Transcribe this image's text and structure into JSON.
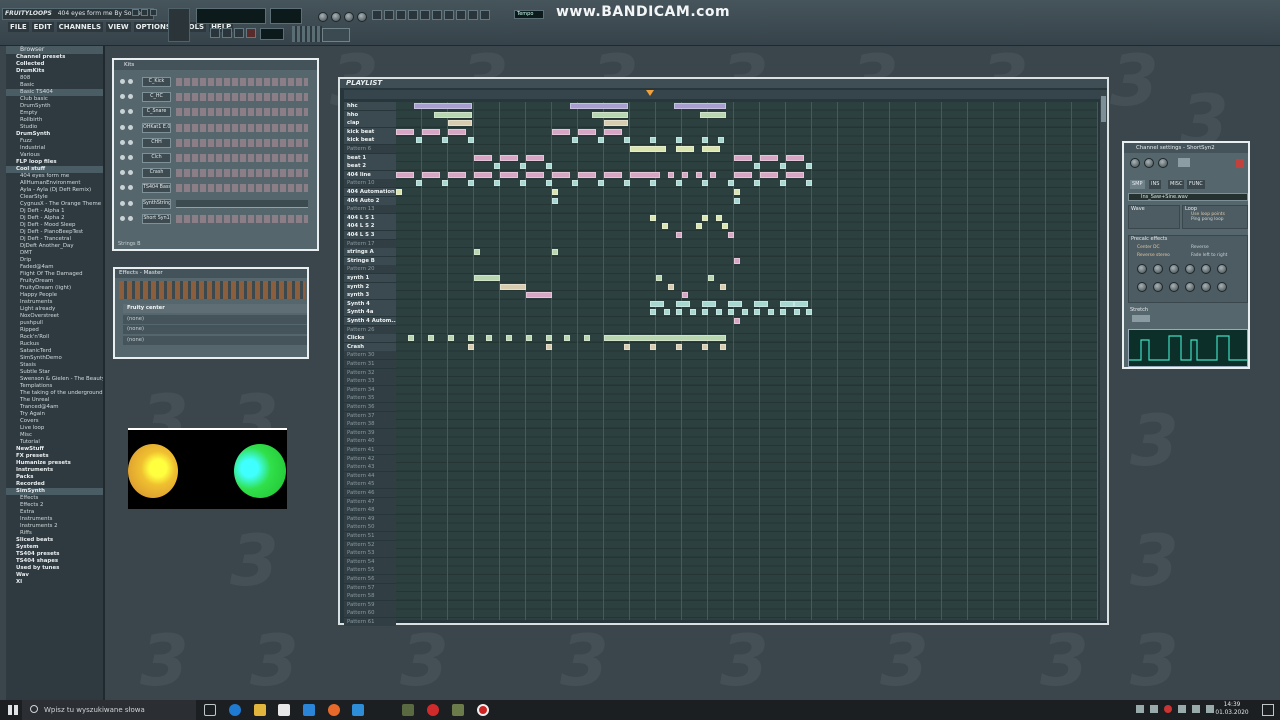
{
  "app": {
    "window_title": "FRUITYLOOPS",
    "song_title": "404 eyes form me By Sorcer",
    "menus": [
      "FILE",
      "EDIT",
      "CHANNELS",
      "VIEW",
      "OPTIONS",
      "TOOLS",
      "HELP"
    ],
    "tempo_label": "Tempo",
    "recorder_watermark": "www.BANDICAM.com",
    "bg_watermark_digit": "3"
  },
  "browser": {
    "title": "Browser",
    "items": [
      {
        "label": "Channel presets",
        "type": "folder"
      },
      {
        "label": "Collected",
        "type": "folder"
      },
      {
        "label": "DrumKits",
        "type": "folder"
      },
      {
        "label": "808",
        "type": "item"
      },
      {
        "label": "Basic",
        "type": "item"
      },
      {
        "label": "Basic TS404",
        "type": "item",
        "selected": true
      },
      {
        "label": "Club basic",
        "type": "item"
      },
      {
        "label": "DrumSynth",
        "type": "item"
      },
      {
        "label": "Empty",
        "type": "item"
      },
      {
        "label": "Rollbirth",
        "type": "item"
      },
      {
        "label": "Studio",
        "type": "item"
      },
      {
        "label": "DrumSynth",
        "type": "folder"
      },
      {
        "label": "Fuzz",
        "type": "item"
      },
      {
        "label": "Industrial",
        "type": "item"
      },
      {
        "label": "Various",
        "type": "item"
      },
      {
        "label": "FLP loop files",
        "type": "folder"
      },
      {
        "label": "Cool stuff",
        "type": "folder",
        "selected": true
      },
      {
        "label": "404 eyes form me",
        "type": "item"
      },
      {
        "label": "AllHumanEnvironment",
        "type": "item"
      },
      {
        "label": "Ayla - Ayla (Dj Deft Remix)",
        "type": "item"
      },
      {
        "label": "ClearStyle",
        "type": "item"
      },
      {
        "label": "CygnusX - The Orange Theme",
        "type": "item"
      },
      {
        "label": "Dj Deft - Alpha 1",
        "type": "item"
      },
      {
        "label": "Dj Deft - Alpha 2",
        "type": "item"
      },
      {
        "label": "Dj Deft - Mood Sleep",
        "type": "item"
      },
      {
        "label": "Dj Deft - PianoBeepTest",
        "type": "item"
      },
      {
        "label": "Dj Deft - Trancetral",
        "type": "item"
      },
      {
        "label": "DjDeft Another_Day",
        "type": "item"
      },
      {
        "label": "DMT",
        "type": "item"
      },
      {
        "label": "Drip",
        "type": "item"
      },
      {
        "label": "Faded@4am",
        "type": "item"
      },
      {
        "label": "Flight Of The Damaged",
        "type": "item"
      },
      {
        "label": "FruityDream",
        "type": "item"
      },
      {
        "label": "FruityDream (light)",
        "type": "item"
      },
      {
        "label": "Happy People",
        "type": "item"
      },
      {
        "label": "Instruments",
        "type": "item"
      },
      {
        "label": "Light already",
        "type": "item"
      },
      {
        "label": "NoxOverstreet",
        "type": "item"
      },
      {
        "label": "pushpull",
        "type": "item"
      },
      {
        "label": "Ripped",
        "type": "item"
      },
      {
        "label": "Rock'n'Roll",
        "type": "item"
      },
      {
        "label": "Ruckus",
        "type": "item"
      },
      {
        "label": "SatanicTerd",
        "type": "item"
      },
      {
        "label": "SimSynthDemo",
        "type": "item"
      },
      {
        "label": "Stasis",
        "type": "item"
      },
      {
        "label": "Subtle Star",
        "type": "item"
      },
      {
        "label": "Swenson & Gielen - The Beauty",
        "type": "item"
      },
      {
        "label": "Templations",
        "type": "item"
      },
      {
        "label": "The taking of the underground",
        "type": "item"
      },
      {
        "label": "The Unreal",
        "type": "item"
      },
      {
        "label": "Tranced@4am",
        "type": "item"
      },
      {
        "label": "Try Again",
        "type": "item"
      },
      {
        "label": "Covers",
        "type": "item"
      },
      {
        "label": "Live loop",
        "type": "item"
      },
      {
        "label": "Misc",
        "type": "item"
      },
      {
        "label": "Tutorial",
        "type": "item"
      },
      {
        "label": "NewStuff",
        "type": "folder"
      },
      {
        "label": "FX presets",
        "type": "folder"
      },
      {
        "label": "Humanize presets",
        "type": "folder"
      },
      {
        "label": "Instruments",
        "type": "folder"
      },
      {
        "label": "Packs",
        "type": "folder"
      },
      {
        "label": "Recorded",
        "type": "folder"
      },
      {
        "label": "SimSynth",
        "type": "folder",
        "selected": true
      },
      {
        "label": "Effects",
        "type": "item"
      },
      {
        "label": "Effects 2",
        "type": "item"
      },
      {
        "label": "Extra",
        "type": "item"
      },
      {
        "label": "Instruments",
        "type": "item"
      },
      {
        "label": "Instruments 2",
        "type": "item"
      },
      {
        "label": "Riffs",
        "type": "item"
      },
      {
        "label": "Sliced beats",
        "type": "folder"
      },
      {
        "label": "System",
        "type": "folder"
      },
      {
        "label": "TS404 presets",
        "type": "folder"
      },
      {
        "label": "TS404 shapes",
        "type": "folder"
      },
      {
        "label": "Used by tunes",
        "type": "folder"
      },
      {
        "label": "Wav",
        "type": "folder"
      },
      {
        "label": "XI",
        "type": "folder"
      }
    ]
  },
  "step_sequencer": {
    "title": "Kits",
    "channels": [
      "C_Kick",
      "C_HC",
      "C_Snare",
      "OHKat1 E.01",
      "CHH",
      "Clch",
      "Crash",
      "TS404 Bass",
      "SynthStrings1",
      "Short Syn1"
    ],
    "footer_label": "Strings B"
  },
  "mixer": {
    "title": "Effects - Master",
    "slots": [
      "Fruity center",
      "(none)",
      "(none)",
      "(none)"
    ]
  },
  "playlist": {
    "title": "PLAYLIST",
    "tracks": [
      "hhc",
      "hho",
      "clap",
      "kick beat",
      "kick beat",
      "Pattern 6",
      "beat 1",
      "beat 2",
      "404 line",
      "Pattern 10",
      "404 Automation",
      "404 Auto 2",
      "Pattern 13",
      "404 L S 1",
      "404 L S 2",
      "404 L S 3",
      "Pattern 17",
      "strings A",
      "Stringe B",
      "Pattern 20",
      "synth 1",
      "synth 2",
      "synth 3",
      "Synth 4",
      "Synth 4a",
      "Synth 4 Autom...",
      "Pattern 26",
      "Clicks",
      "Crash",
      "Pattern 30",
      "Pattern 31",
      "Pattern 32",
      "Pattern 33",
      "Pattern 34",
      "Pattern 35",
      "Pattern 36",
      "Pattern 37",
      "Pattern 38",
      "Pattern 39",
      "Pattern 40",
      "Pattern 41",
      "Pattern 42",
      "Pattern 43",
      "Pattern 44",
      "Pattern 45",
      "Pattern 46",
      "Pattern 47",
      "Pattern 48",
      "Pattern 49",
      "Pattern 50",
      "Pattern 51",
      "Pattern 52",
      "Pattern 53",
      "Pattern 54",
      "Pattern 55",
      "Pattern 56",
      "Pattern 57",
      "Pattern 58",
      "Pattern 59",
      "Pattern 60",
      "Pattern 61"
    ],
    "named_track_count": 29
  },
  "channel_settings": {
    "title": "Channel settings - ShortSyn2",
    "tabs": [
      "SMP",
      "INS",
      "MISC",
      "FUNC"
    ],
    "sample_file": "Ins_Saw+Sine.wav",
    "wave_label": "Wave",
    "loop_label": "Loop",
    "loop_options": [
      "Use loop points",
      "Ping pong loop"
    ],
    "precomputed_label": "Precalc effects",
    "effect_options": [
      "Center DC",
      "Reverse",
      "Reverse stereo",
      "Fade left to right"
    ],
    "stretch_label": "Stretch"
  },
  "taskbar": {
    "search_placeholder": "Wpisz tu wyszukiwane słowa",
    "time": "14:39",
    "date": "01.03.2020"
  }
}
